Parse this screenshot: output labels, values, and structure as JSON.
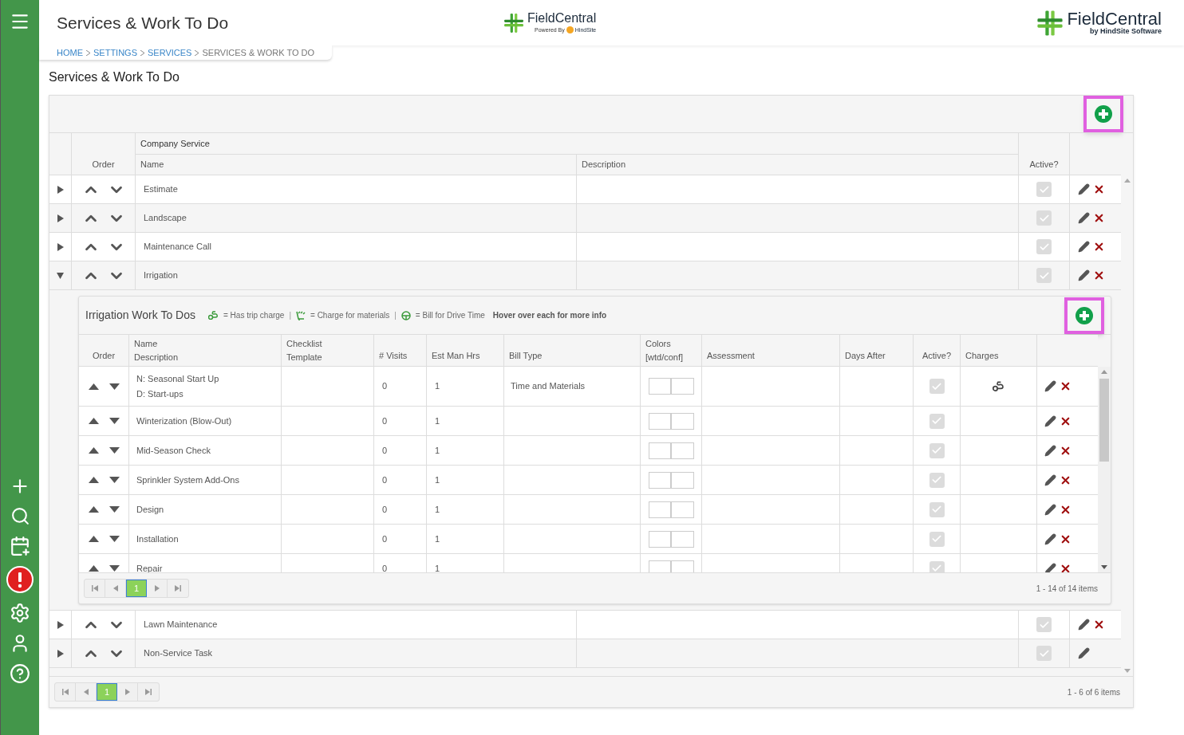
{
  "header": {
    "title": "Services & Work To Do",
    "logo_center": {
      "name": "FieldCentral",
      "tagline": "Powered By",
      "partner": "HindSite"
    },
    "logo_right": {
      "name": "FieldCentral",
      "tagline": "by HindSite Software"
    }
  },
  "breadcrumb": [
    {
      "label": "HOME",
      "link": true
    },
    {
      "label": "SETTINGS",
      "link": true
    },
    {
      "label": "SERVICES",
      "link": true
    },
    {
      "label": "SERVICES & WORK TO DO",
      "link": false
    }
  ],
  "page_title": "Services & Work To Do",
  "services_table": {
    "group_header": "Company Service",
    "columns": [
      "Order",
      "Name",
      "Description",
      "Active?"
    ],
    "rows": [
      {
        "name": "Estimate",
        "active": true,
        "deletable": true,
        "expanded": false
      },
      {
        "name": "Landscape",
        "active": true,
        "deletable": true,
        "expanded": false
      },
      {
        "name": "Maintenance Call",
        "active": true,
        "deletable": true,
        "expanded": false
      },
      {
        "name": "Irrigation",
        "active": true,
        "deletable": true,
        "expanded": true
      },
      {
        "name": "Lawn Maintenance",
        "active": true,
        "deletable": true,
        "expanded": false
      },
      {
        "name": "Non-Service Task",
        "active": true,
        "deletable": false,
        "expanded": false
      }
    ],
    "pager": {
      "pages": [
        {
          "label": "1",
          "selected": true
        }
      ],
      "summary": "1 - 6 of 6 items"
    }
  },
  "work_todos": {
    "title": "Irrigation Work To Dos",
    "legend": [
      {
        "kind": "trip",
        "label": "= Has trip charge"
      },
      {
        "kind": "materials",
        "label": "= Charge for materials"
      },
      {
        "kind": "drive",
        "label": "= Bill for Drive Time"
      }
    ],
    "separator": "|",
    "hint": "Hover over each for more info",
    "columns": [
      "Order",
      "Name",
      "Description",
      "Checklist",
      "Template",
      "# Visits",
      "Est Man Hrs",
      "Bill Type",
      "Colors",
      "[wtd/conf]",
      "Assessment",
      "Days After",
      "Active?",
      "Charges"
    ],
    "rows": [
      {
        "name": "N: Seasonal Start Up",
        "description": "D: Start-ups",
        "visits": "0",
        "est_man_hrs": "1",
        "bill_type": "Time and Materials",
        "active": true,
        "charges": [
          {
            "kind": "trip"
          }
        ]
      },
      {
        "name": "Winterization (Blow-Out)",
        "visits": "0",
        "est_man_hrs": "1",
        "active": true
      },
      {
        "name": "Mid-Season Check",
        "visits": "0",
        "est_man_hrs": "1",
        "active": true
      },
      {
        "name": "Sprinkler System Add-Ons",
        "visits": "0",
        "est_man_hrs": "1",
        "active": true
      },
      {
        "name": "Design",
        "visits": "0",
        "est_man_hrs": "1",
        "active": true
      },
      {
        "name": "Installation",
        "visits": "0",
        "est_man_hrs": "1",
        "active": true
      },
      {
        "name": "Repair",
        "visits": "0",
        "est_man_hrs": "1",
        "active": true
      }
    ],
    "pager": {
      "pages": [
        {
          "label": "1",
          "selected": true
        }
      ],
      "summary": "1 - 14 of 14 items"
    }
  }
}
